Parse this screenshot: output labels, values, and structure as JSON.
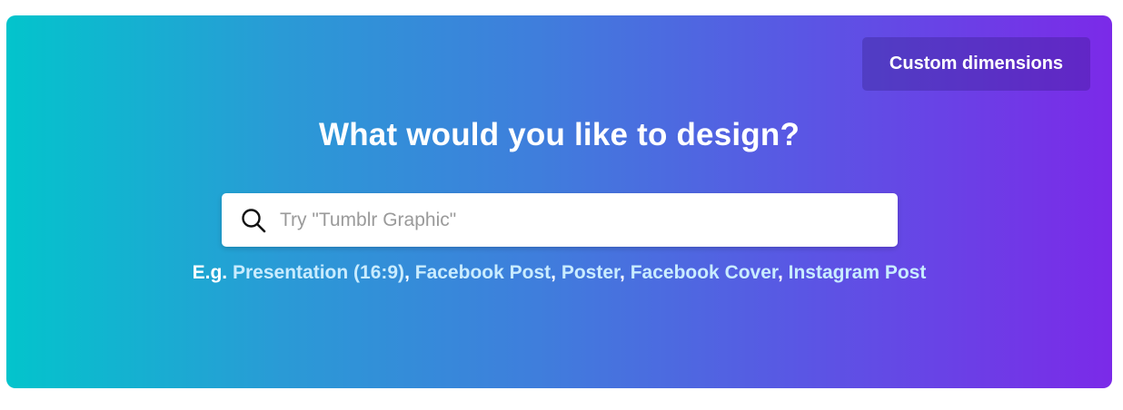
{
  "header": {
    "custom_button_label": "Custom dimensions",
    "headline": "What would you like to design?"
  },
  "search": {
    "icon": "search-icon",
    "placeholder": "Try \"Tumblr Graphic\"",
    "value": ""
  },
  "examples": {
    "prefix": "E.g.",
    "items": [
      {
        "label": "Presentation (16:9)"
      },
      {
        "label": "Facebook Post"
      },
      {
        "label": "Poster"
      },
      {
        "label": "Facebook Cover"
      },
      {
        "label": "Instagram Post"
      }
    ],
    "separator": ","
  },
  "colors": {
    "gradient_start": "#03c4cc",
    "gradient_mid": "#3f7edc",
    "gradient_end": "#7b2ae8",
    "link": "#c9ecff"
  }
}
